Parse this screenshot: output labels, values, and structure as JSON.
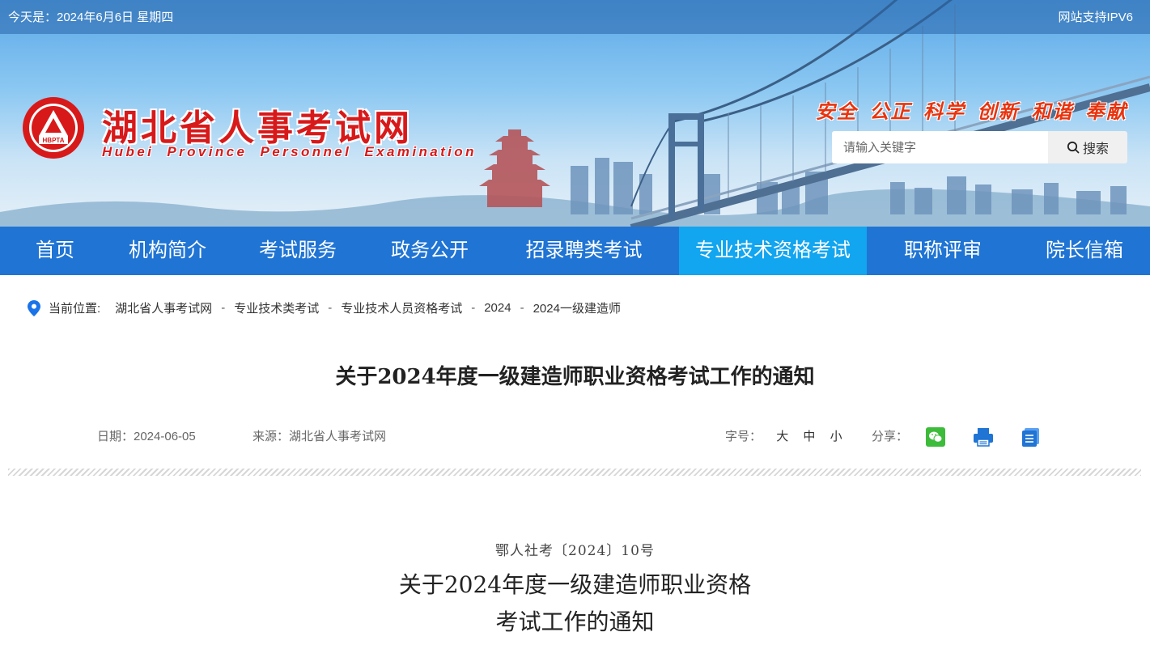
{
  "topbar": {
    "date": "今天是：2024年6月6日 星期四",
    "ipv6": "网站支持IPV6"
  },
  "logo": {
    "badge": "HBPTA",
    "name_cn": "湖北省人事考试网",
    "name_en": "Hubei Province Personnel Examination"
  },
  "slogan": "安全 公正 科学 创新 和谐 奉献",
  "search": {
    "placeholder": "请输入关键字",
    "button": "搜索"
  },
  "nav": [
    {
      "label": "首页"
    },
    {
      "label": "机构简介"
    },
    {
      "label": "考试服务"
    },
    {
      "label": "政务公开"
    },
    {
      "label": "招录聘类考试"
    },
    {
      "label": "专业技术资格考试",
      "active": true
    },
    {
      "label": "职称评审"
    },
    {
      "label": "院长信箱"
    }
  ],
  "breadcrumb": {
    "label": "当前位置:",
    "items": [
      "湖北省人事考试网",
      "专业技术类考试",
      "专业技术人员资格考试",
      "2024",
      "2024一级建造师"
    ],
    "separator": "-"
  },
  "article": {
    "title": "关于2024年度一级建造师职业资格考试工作的通知",
    "date": "日期：2024-06-05",
    "source": "来源：湖北省人事考试网",
    "font_size": {
      "label": "字号：",
      "large": "大",
      "medium": "中",
      "small": "小"
    },
    "share_label": "分享：",
    "doc_number": "鄂人社考〔2024〕10号",
    "doc_title_line1": "关于2024年度一级建造师职业资格",
    "doc_title_line2": "考试工作的通知"
  },
  "colors": {
    "nav_bg": "#1f74d4",
    "nav_active": "#12a5f0",
    "brand_red": "#d8191a",
    "slogan": "#e8340f"
  },
  "icons": [
    "location-pin-icon",
    "search-icon",
    "wechat-icon",
    "print-icon",
    "document-icon"
  ]
}
